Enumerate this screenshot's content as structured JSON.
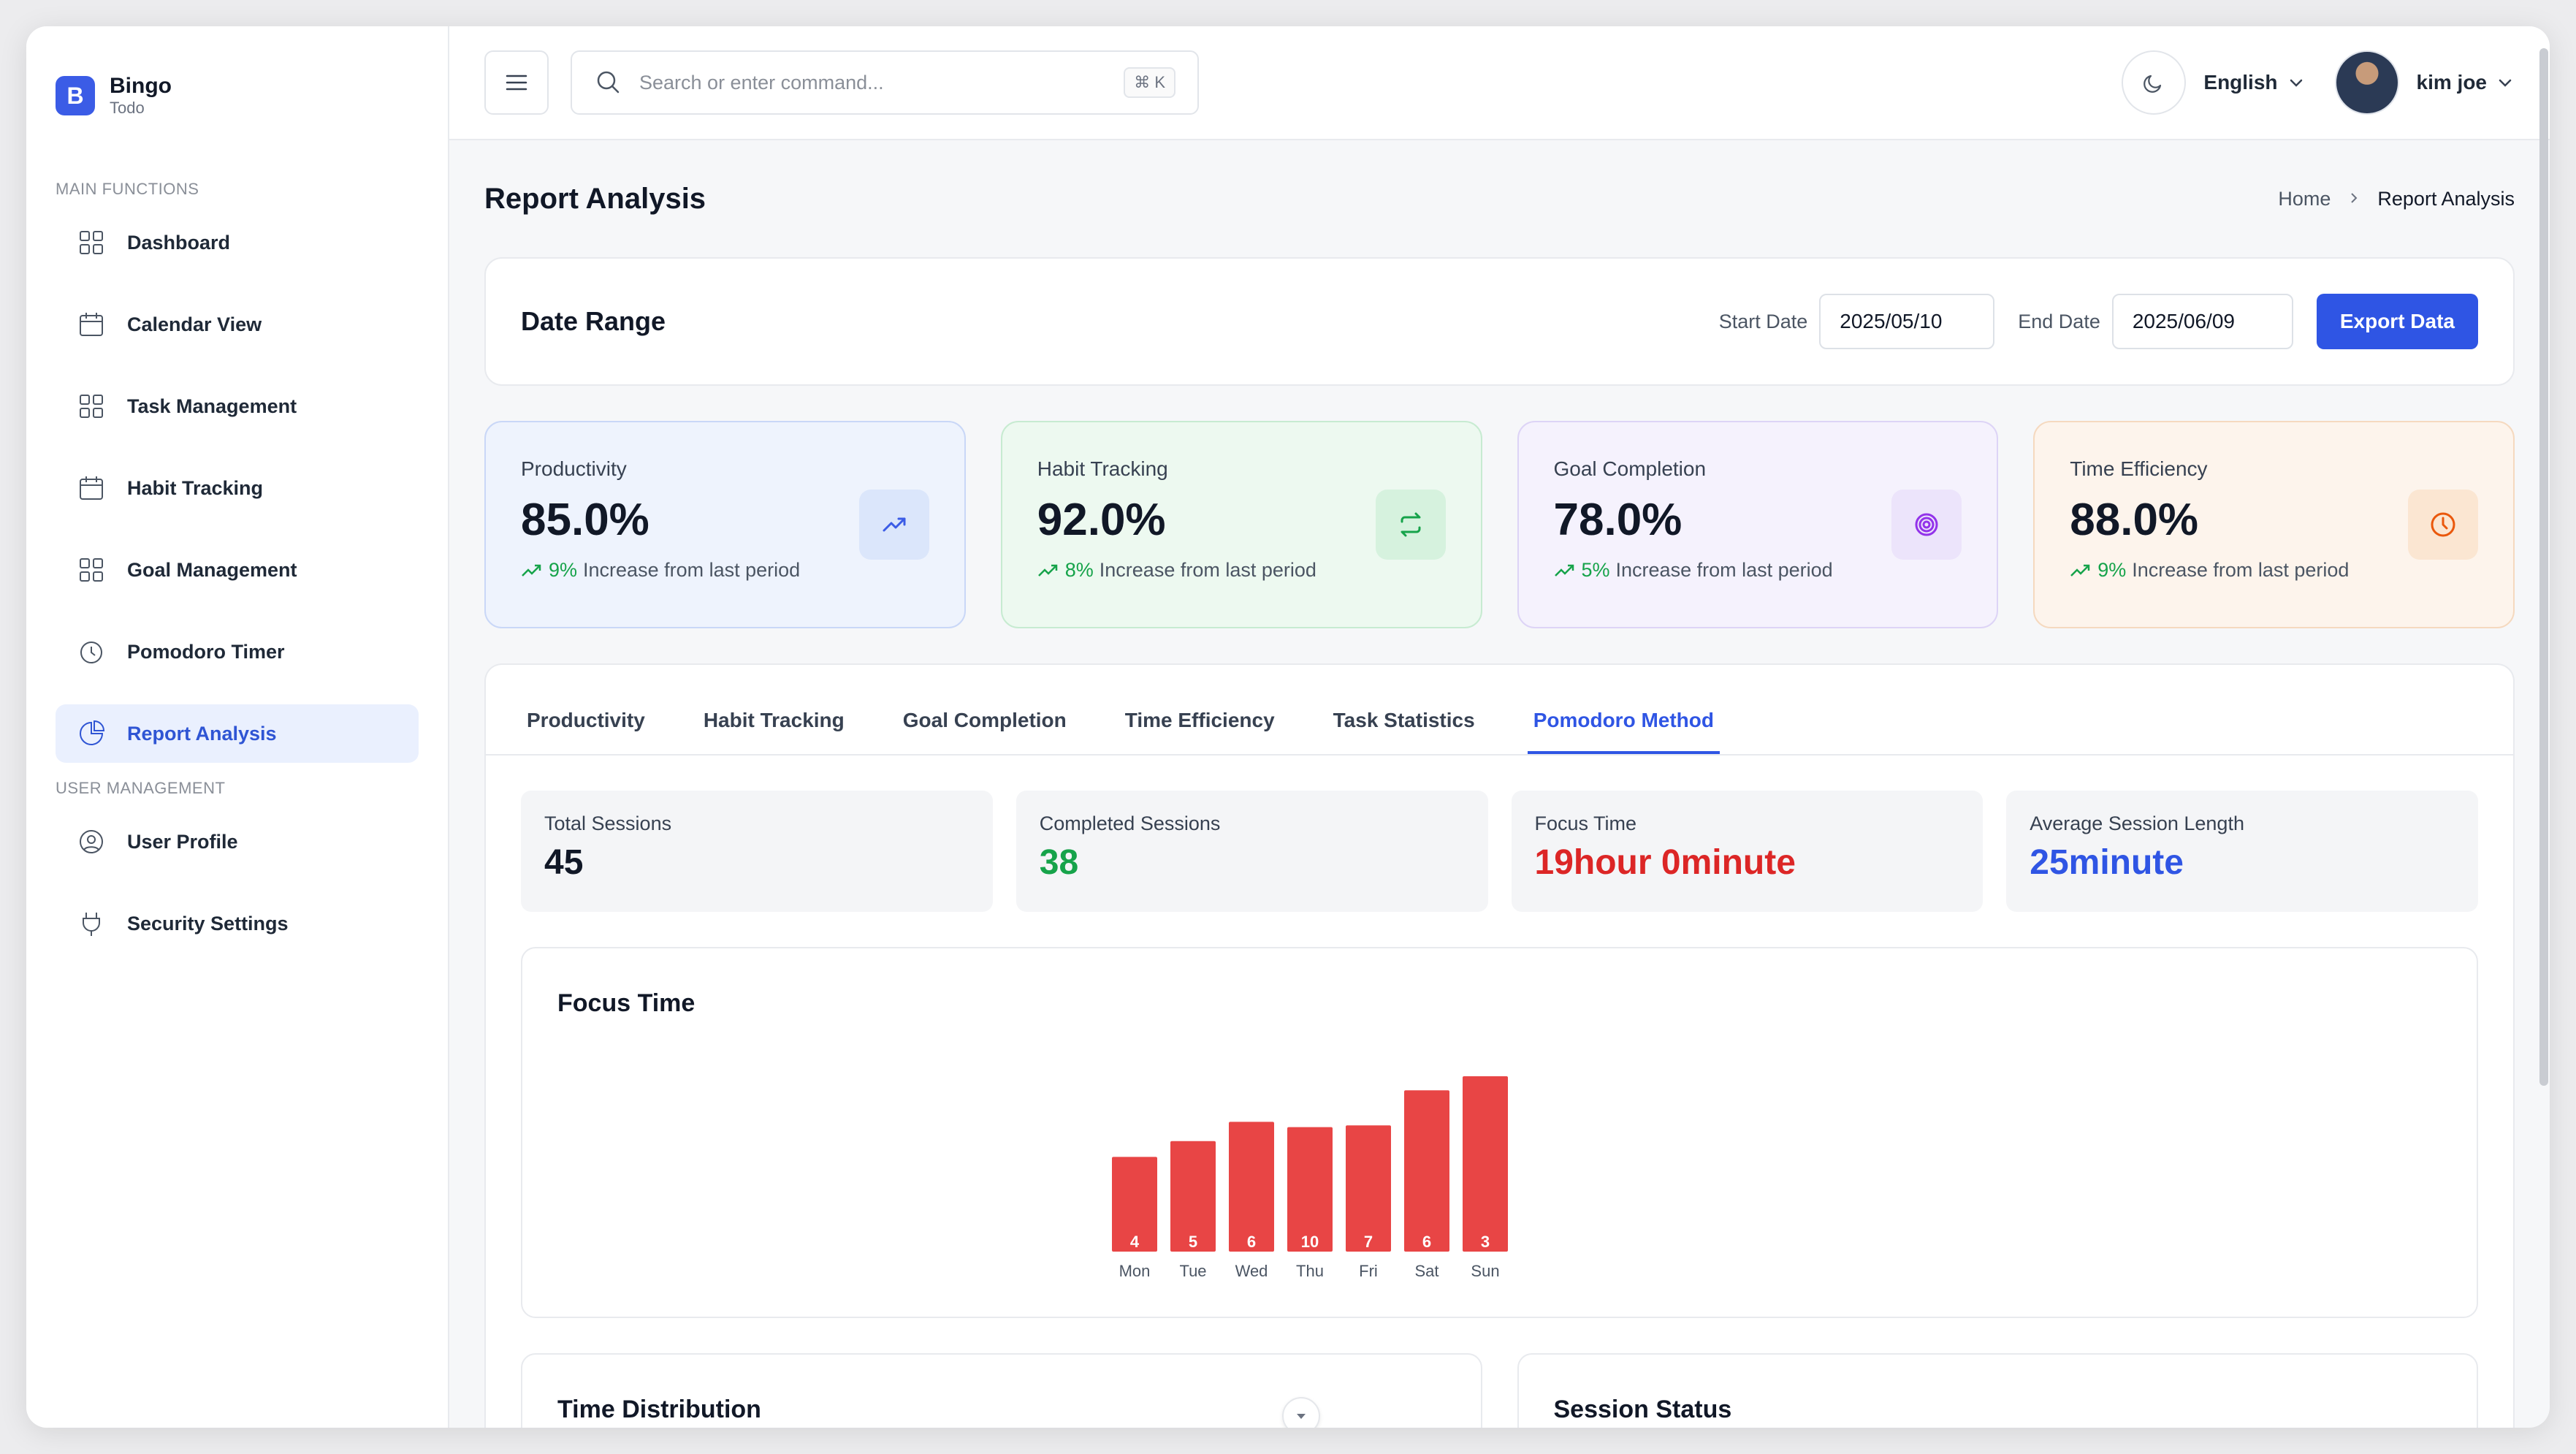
{
  "brand": {
    "name": "Bingo",
    "sub": "Todo",
    "logo_letter": "B"
  },
  "sidebar": {
    "sections": [
      {
        "title": "MAIN FUNCTIONS",
        "items": [
          {
            "label": "Dashboard",
            "icon": "grid-icon"
          },
          {
            "label": "Calendar View",
            "icon": "calendar-icon"
          },
          {
            "label": "Task Management",
            "icon": "grid-icon"
          },
          {
            "label": "Habit Tracking",
            "icon": "calendar-icon"
          },
          {
            "label": "Goal Management",
            "icon": "grid-icon"
          },
          {
            "label": "Pomodoro Timer",
            "icon": "clock-icon"
          },
          {
            "label": "Report Analysis",
            "icon": "pie-chart-icon",
            "active": true
          }
        ]
      },
      {
        "title": "USER MANAGEMENT",
        "items": [
          {
            "label": "User Profile",
            "icon": "user-icon"
          },
          {
            "label": "Security Settings",
            "icon": "plug-icon"
          }
        ]
      }
    ]
  },
  "topbar": {
    "search_placeholder": "Search or enter command...",
    "shortcut": "⌘ K",
    "language": "English",
    "user_name": "kim joe"
  },
  "page": {
    "title": "Report Analysis",
    "breadcrumb": {
      "home": "Home",
      "current": "Report Analysis"
    }
  },
  "date_range": {
    "title": "Date Range",
    "start_label": "Start Date",
    "start_value": "2025/05/10",
    "end_label": "End Date",
    "end_value": "2025/06/09",
    "export_label": "Export Data"
  },
  "stats": [
    {
      "label": "Productivity",
      "value": "85.0%",
      "pct": "9%",
      "trend_text": "Increase from last period",
      "icon": "trending-up-icon",
      "color": "#3b5ce6"
    },
    {
      "label": "Habit Tracking",
      "value": "92.0%",
      "pct": "8%",
      "trend_text": "Increase from last period",
      "icon": "repeat-icon",
      "color": "#16a34a"
    },
    {
      "label": "Goal Completion",
      "value": "78.0%",
      "pct": "5%",
      "trend_text": "Increase from last period",
      "icon": "target-icon",
      "color": "#9333ea"
    },
    {
      "label": "Time Efficiency",
      "value": "88.0%",
      "pct": "9%",
      "trend_text": "Increase from last period",
      "icon": "clock-icon",
      "color": "#ea580c"
    }
  ],
  "tabs": [
    {
      "label": "Productivity"
    },
    {
      "label": "Habit Tracking"
    },
    {
      "label": "Goal Completion"
    },
    {
      "label": "Time Efficiency"
    },
    {
      "label": "Task Statistics"
    },
    {
      "label": "Pomodoro Method",
      "active": true
    }
  ],
  "metrics": [
    {
      "label": "Total Sessions",
      "value": "45",
      "color": "#111827"
    },
    {
      "label": "Completed Sessions",
      "value": "38",
      "color": "#16a34a"
    },
    {
      "label": "Focus Time",
      "value": "19hour 0minute",
      "color": "#dc2626"
    },
    {
      "label": "Average Session Length",
      "value": "25minute",
      "color": "#2f55e4"
    }
  ],
  "focus_chart_title": "Focus Time",
  "chart_data": {
    "type": "bar",
    "title": "Focus Time",
    "categories": [
      "Mon",
      "Tue",
      "Wed",
      "Thu",
      "Fri",
      "Sat",
      "Sun"
    ],
    "bar_heights": [
      0.54,
      0.63,
      0.74,
      0.71,
      0.72,
      0.92,
      1.0
    ],
    "data_labels": [
      "4",
      "5",
      "6",
      "10",
      "7",
      "6",
      "3"
    ],
    "color": "#e84545",
    "grid": false,
    "legend": "none"
  },
  "bottom": {
    "time_distribution": "Time Distribution",
    "session_status": "Session Status"
  }
}
